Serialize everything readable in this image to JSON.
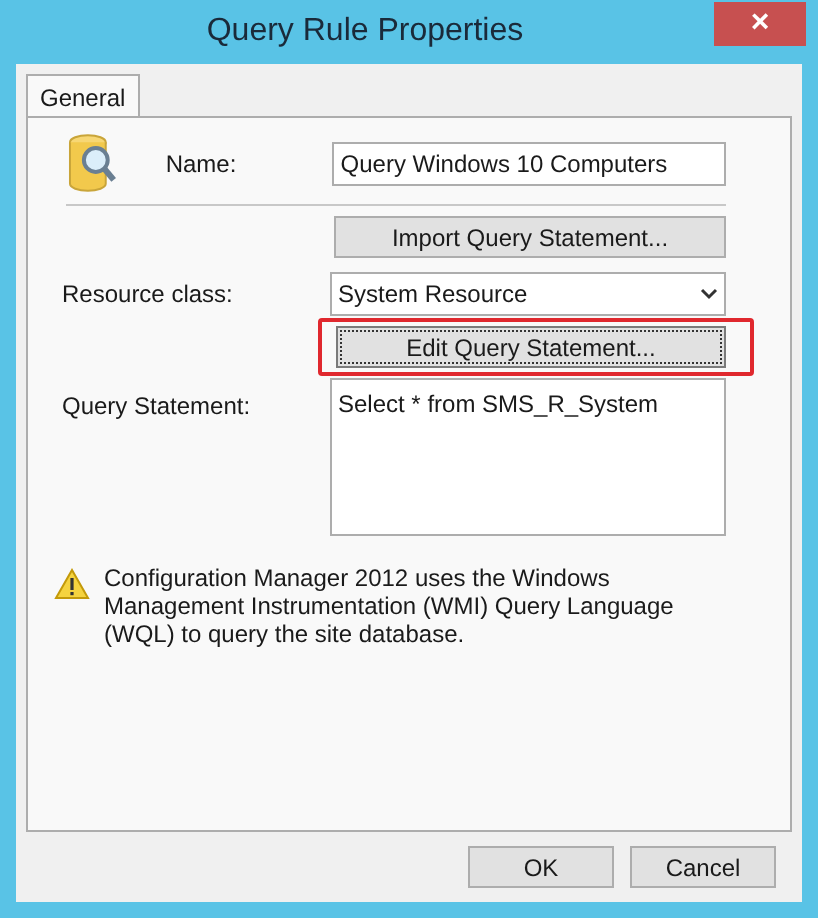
{
  "window": {
    "title": "Query Rule Properties",
    "close": "×"
  },
  "tabs": [
    {
      "label": "General",
      "selected": true
    }
  ],
  "name_field": {
    "label": "Name:",
    "value": "Query Windows 10 Computers"
  },
  "import_button": {
    "label": "Import Query Statement..."
  },
  "resource_class": {
    "label": "Resource class:",
    "value": "System Resource"
  },
  "edit_button": {
    "label": "Edit Query Statement...",
    "highlighted": true
  },
  "query_statement": {
    "label": "Query Statement:",
    "value": "Select * from SMS_R_System"
  },
  "note": "Configuration Manager 2012 uses the Windows Management Instrumentation (WMI) Query Language (WQL) to query the site database.",
  "buttons": [
    "OK",
    "Cancel"
  ]
}
